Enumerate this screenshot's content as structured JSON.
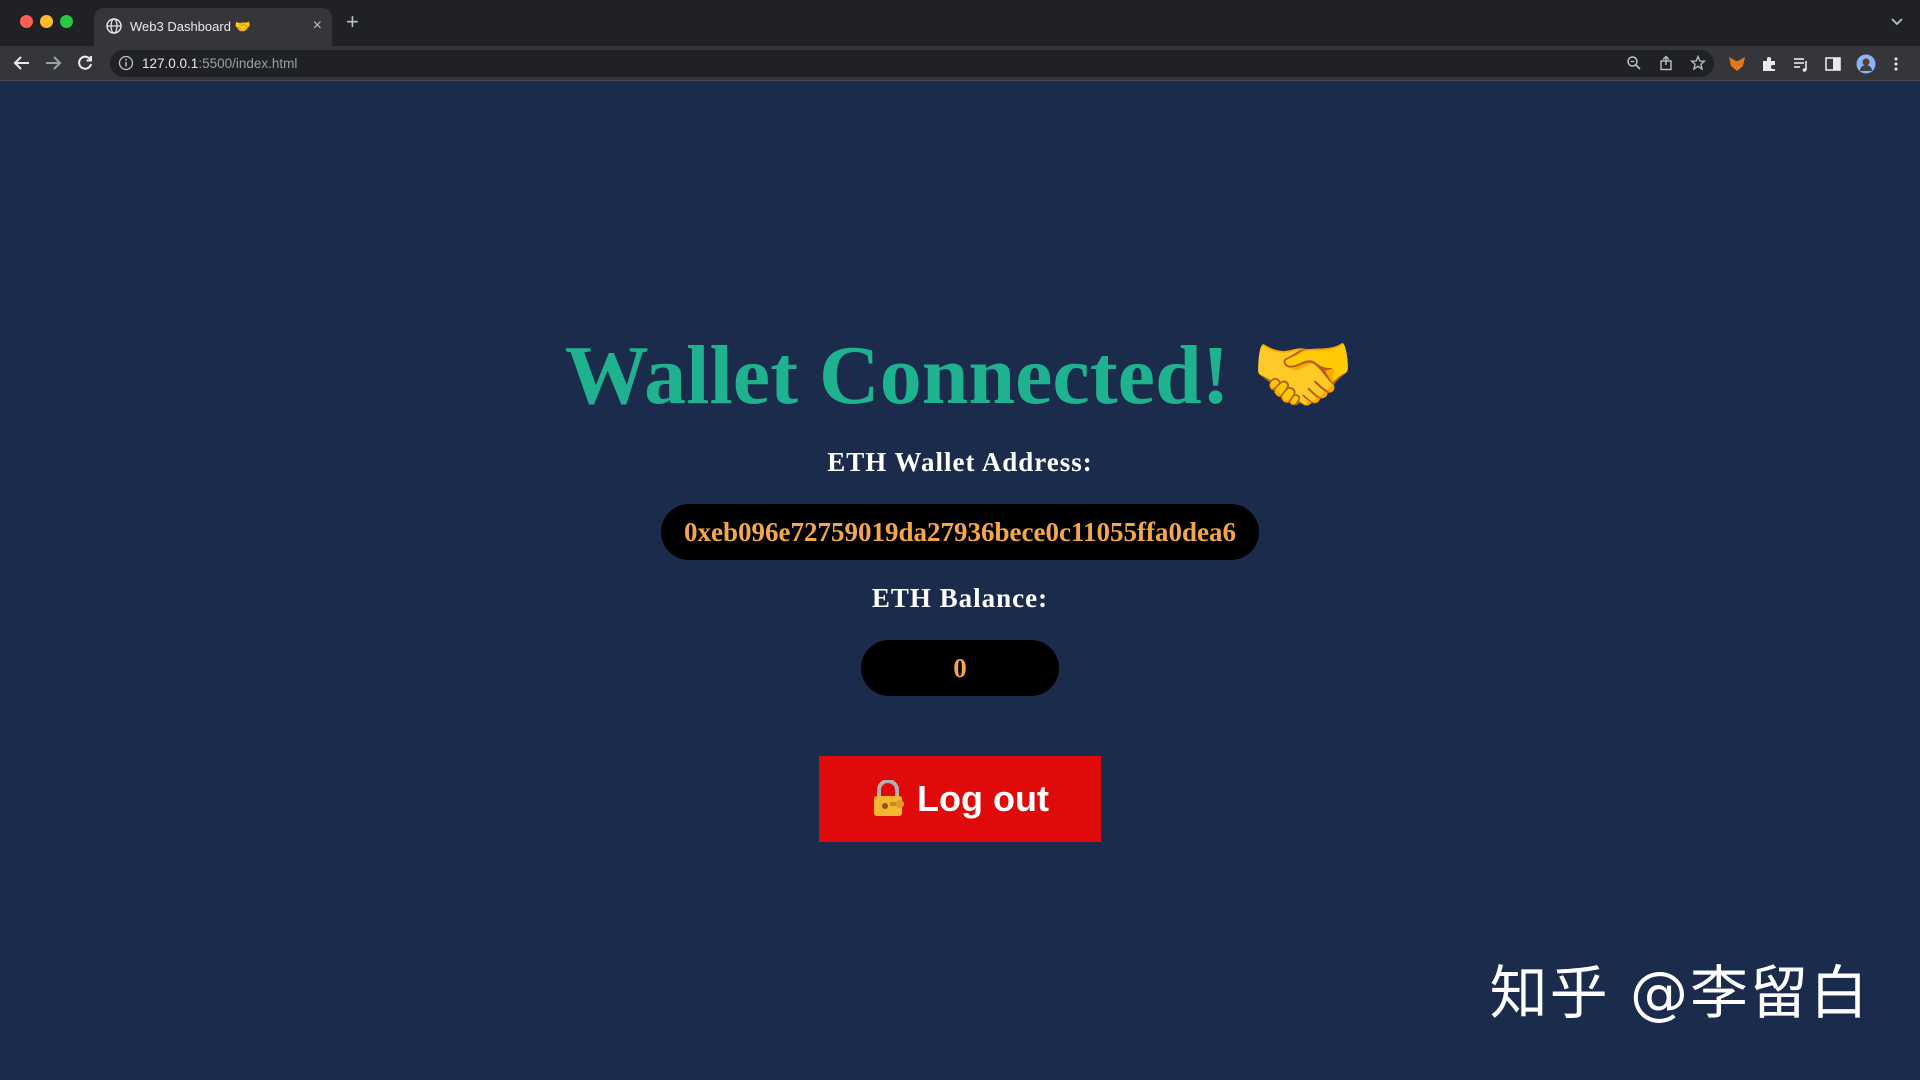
{
  "browser": {
    "tab_title": "Web3 Dashboard 🤝",
    "tab_close": "×",
    "new_tab": "+",
    "url_host": "127.0.0.1",
    "url_rest": ":5500/index.html"
  },
  "page": {
    "headline": "Wallet Connected! 🤝",
    "address_label": "ETH Wallet Address:",
    "address_value": "0xeb096e72759019da27936bece0c11055ffa0dea6",
    "balance_label": "ETH Balance:",
    "balance_value": "0",
    "logout_label": "Log out"
  },
  "watermark": "知乎 @李留白",
  "colors": {
    "page_background": "#1a2b4b",
    "headline": "#1fb28e",
    "value_text": "#f4a74a",
    "logout_button": "#e00a0a"
  }
}
